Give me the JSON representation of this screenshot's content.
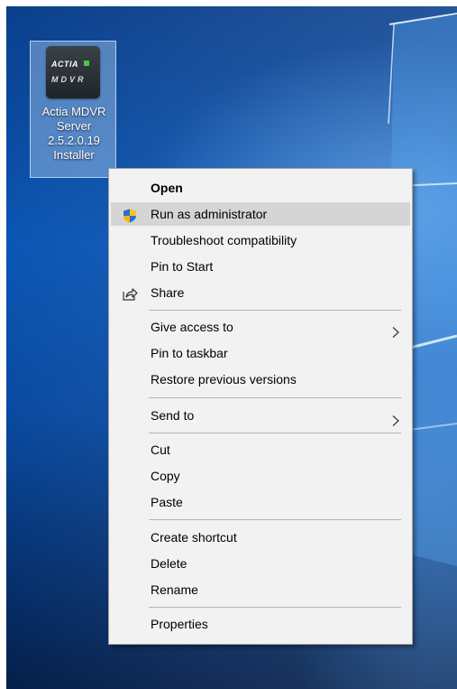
{
  "desktop_icon": {
    "brand_text": "ACTIA",
    "sub_text": "MDVR",
    "label": "Actia MDVR Server 2.5.2.0.19 Installer",
    "label_lines": [
      "Actia MDVR",
      "Server",
      "2.5.2.0.19",
      "Installer"
    ]
  },
  "context_menu": {
    "open": "Open",
    "run_as_admin": "Run as administrator",
    "troubleshoot": "Troubleshoot compatibility",
    "pin_to_start": "Pin to Start",
    "share": "Share",
    "give_access_to": "Give access to",
    "pin_to_taskbar": "Pin to taskbar",
    "restore_previous_versions": "Restore previous versions",
    "send_to": "Send to",
    "cut": "Cut",
    "copy": "Copy",
    "paste": "Paste",
    "create_shortcut": "Create shortcut",
    "delete": "Delete",
    "rename": "Rename",
    "properties": "Properties"
  },
  "icons": {
    "run_as_admin": "uac-shield-icon",
    "share": "share-icon",
    "submenu": "chevron-right-icon"
  },
  "colors": {
    "menu_background": "#f2f2f2",
    "highlight": "#d5d5d5",
    "desktop": "#0b56b4"
  }
}
